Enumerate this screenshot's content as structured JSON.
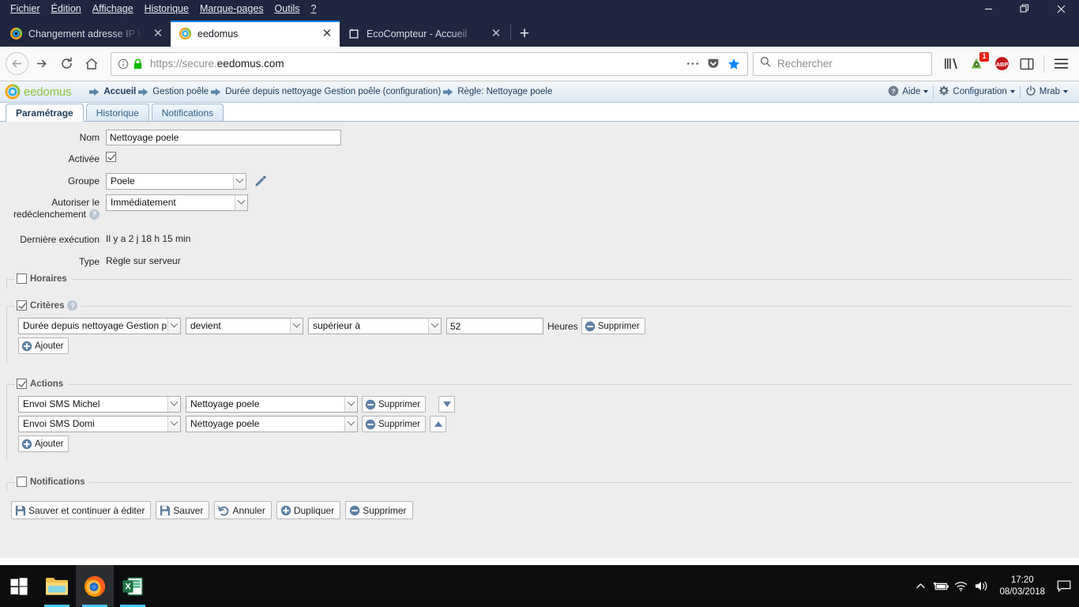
{
  "browser": {
    "menubar": [
      {
        "label": "Fichier",
        "accel": "F"
      },
      {
        "label": "Édition",
        "accel": "n"
      },
      {
        "label": "Affichage",
        "accel": "A"
      },
      {
        "label": "Historique",
        "accel": "H"
      },
      {
        "label": "Marque-pages",
        "accel": "M"
      },
      {
        "label": "Outils",
        "accel": "O"
      },
      {
        "label": "?",
        "accel": ""
      }
    ],
    "window_controls": {
      "minimize": "minimize-icon",
      "restore": "restore-icon",
      "close": "close-icon"
    },
    "tabs": [
      {
        "title": "Changement adresse IP box eed",
        "favicon": "eedomus-favicon",
        "active": false
      },
      {
        "title": "eedomus",
        "favicon": "eedomus-favicon",
        "active": true
      },
      {
        "title": "EcoCompteur - Accueil",
        "favicon": "ecocompteur-favicon",
        "active": false
      }
    ],
    "newtab_label": "+",
    "nav": {
      "back": "back-arrow-icon",
      "forward": "forward-arrow-icon",
      "reload": "reload-icon",
      "home": "home-icon"
    },
    "urlbar": {
      "url_prefix": "https://secure.",
      "url_domain": "eedomus.com",
      "full_url": "https://secure.eedomus.com",
      "identity_icon": "info-circle-icon",
      "lock_icon": "padlock-icon",
      "lock_color": "#12bc00",
      "page_actions": "ellipsis-icon",
      "pocket_icon": "pocket-icon",
      "bookmark_icon": "star-icon",
      "bookmark_color": "#0a84ff"
    },
    "search": {
      "placeholder": "Rechercher",
      "icon": "search-icon"
    },
    "toolbar_icons": [
      {
        "name": "library-icon",
        "badge": ""
      },
      {
        "name": "extension-icon",
        "badge": "1"
      },
      {
        "name": "adblockplus-icon",
        "label": "ABP",
        "badge": ""
      },
      {
        "name": "sidebar-icon",
        "badge": ""
      },
      {
        "name": "hamburger-menu-icon",
        "badge": ""
      }
    ]
  },
  "eedomus": {
    "logo_text": "eedomus",
    "breadcrumb": [
      {
        "label": "Accueil",
        "bold": true
      },
      {
        "label": "Gestion poêle",
        "bold": false
      },
      {
        "label": "Durée depuis nettoyage Gestion poêle (configuration)",
        "bold": false
      },
      {
        "label": "Règle: Nettoyage poele",
        "bold": false
      }
    ],
    "header_menu": [
      {
        "label": "Aide",
        "icon": "help-circle-icon"
      },
      {
        "label": "Configuration",
        "icon": "gear-icon"
      },
      {
        "label": "Mrab",
        "icon": "power-icon"
      }
    ],
    "tabs": [
      {
        "label": "Paramétrage",
        "active": true
      },
      {
        "label": "Historique",
        "active": false
      },
      {
        "label": "Notifications",
        "active": false
      }
    ],
    "form": {
      "nom_label": "Nom",
      "nom_value": "Nettoyage poele",
      "activee_label": "Activée",
      "activee_checked": true,
      "groupe_label": "Groupe",
      "groupe_value": "Poele",
      "autoriser_label_line1": "Autoriser le",
      "autoriser_label_line2": "redéclenchement",
      "autoriser_value": "Immédiatement",
      "derniere_label": "Dernière exécution",
      "derniere_value": "Il y a 2 j 18 h 15 min",
      "type_label": "Type",
      "type_value": "Règle sur serveur"
    },
    "sections": {
      "horaires": {
        "legend": "Horaires",
        "checked": false
      },
      "criteres": {
        "legend": "Critères",
        "checked": true,
        "rows": [
          {
            "source": "Durée depuis nettoyage Gestion p",
            "event": "devient",
            "operator": "supérieur à",
            "value": "52",
            "unit": "Heures",
            "delete_label": "Supprimer"
          }
        ],
        "add_label": "Ajouter"
      },
      "actions": {
        "legend": "Actions",
        "checked": true,
        "rows": [
          {
            "action": "Envoi SMS Michel",
            "target": "Nettoyage poele",
            "delete_label": "Supprimer",
            "move": "down"
          },
          {
            "action": "Envoi SMS Domi",
            "target": "Nettoyage poele",
            "delete_label": "Supprimer",
            "move": "up"
          }
        ],
        "add_label": "Ajouter"
      },
      "notifications": {
        "legend": "Notifications",
        "checked": false
      }
    },
    "footer_buttons": [
      {
        "label": "Sauver et continuer à éditer",
        "icon": "save-icon"
      },
      {
        "label": "Sauver",
        "icon": "save-icon"
      },
      {
        "label": "Annuler",
        "icon": "undo-icon"
      },
      {
        "label": "Dupliquer",
        "icon": "plus-circle-icon"
      },
      {
        "label": "Supprimer",
        "icon": "minus-circle-icon"
      }
    ]
  },
  "taskbar": {
    "start": "windows-start-icon",
    "apps": [
      {
        "name": "file-explorer-icon",
        "running": true,
        "active": false
      },
      {
        "name": "firefox-icon",
        "running": true,
        "active": true
      },
      {
        "name": "excel-icon",
        "running": true,
        "active": false
      }
    ],
    "tray": [
      {
        "name": "show-hidden-icons-chevron"
      },
      {
        "name": "battery-icon"
      },
      {
        "name": "wifi-icon"
      },
      {
        "name": "volume-icon"
      }
    ],
    "clock_time": "17:20",
    "clock_date": "08/03/2018",
    "action_center": "notification-icon"
  }
}
